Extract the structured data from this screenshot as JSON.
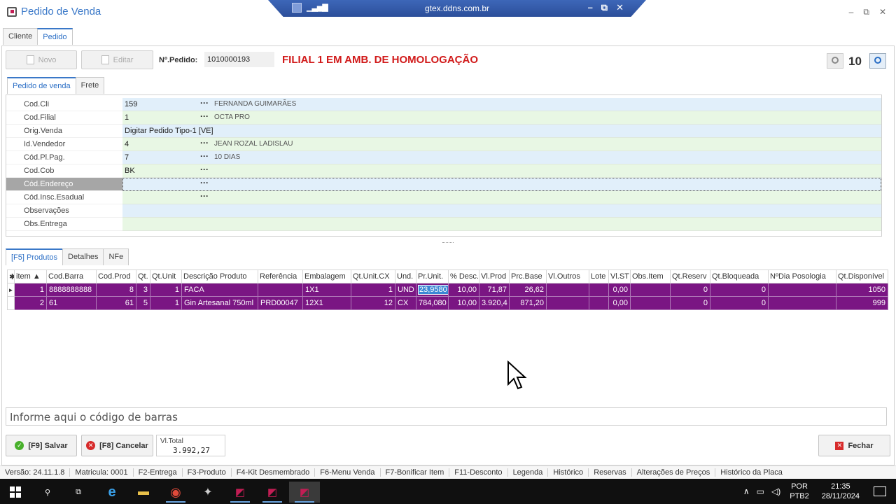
{
  "window": {
    "title": "Pedido de Venda",
    "rdp_host": "gtex.ddns.com.br"
  },
  "top_tabs": [
    "Cliente",
    "Pedido"
  ],
  "toolbar": {
    "new_label": "Novo",
    "edit_label": "Editar",
    "order_label": "Nº.Pedido:",
    "order_number": "1010000193",
    "banner": "FILIAL 1 EM AMB. DE HOMOLOGAÇÃO",
    "zoom": "10"
  },
  "form_tabs": [
    "Pedido de venda",
    "Frete"
  ],
  "form_rows": [
    {
      "label": "Cod.Cli",
      "code": "159",
      "dots": "···",
      "desc": "FERNANDA GUIMARÃES"
    },
    {
      "label": "Cod.Filial",
      "code": "1",
      "dots": "···",
      "desc": "OCTA PRO"
    },
    {
      "label": "Orig.Venda",
      "code": "Digitar Pedido Tipo-1 [VE]",
      "dots": "",
      "desc": ""
    },
    {
      "label": "Id.Vendedor",
      "code": "4",
      "dots": "···",
      "desc": "JEAN ROZAL LADISLAU"
    },
    {
      "label": "Cód.Pl.Pag.",
      "code": "7",
      "dots": "···",
      "desc": "10 DIAS"
    },
    {
      "label": "Cod.Cob",
      "code": "BK",
      "dots": "···",
      "desc": ""
    },
    {
      "label": "Cód.Endereço",
      "code": "",
      "dots": "···",
      "desc": ""
    },
    {
      "label": "Cód.Insc.Esadual",
      "code": "",
      "dots": "···",
      "desc": ""
    },
    {
      "label": "Observações",
      "code": "",
      "dots": "",
      "desc": ""
    },
    {
      "label": "Obs.Entrega",
      "code": "",
      "dots": "",
      "desc": ""
    }
  ],
  "product_tabs": [
    "[F5] Produtos",
    "Detalhes",
    "NFe"
  ],
  "products": {
    "columns": [
      "item",
      "Cod.Barra",
      "Cod.Prod",
      "Qt.",
      "Qt.Unit",
      "Descrição Produto",
      "Referência",
      "Embalagem",
      "Qt.Unit.CX",
      "Und.",
      "Pr.Unit.",
      "% Desc.",
      "Vl.Prod",
      "Prc.Base",
      "Vl.Outros",
      "Lote",
      "Vl.ST",
      "Obs.Item",
      "Qt.Reserv",
      "Qt.Bloqueada",
      "NºDia Posologia",
      "Qt.Disponível"
    ],
    "rows": [
      [
        "1",
        "8888888888",
        "8",
        "3",
        "1",
        "FACA",
        "",
        "1X1",
        "1",
        "UND",
        "23,9580",
        "10,00",
        "71,87",
        "26,62",
        "",
        "",
        "0,00",
        "",
        "0",
        "0",
        "",
        "1050"
      ],
      [
        "2",
        "61",
        "61",
        "5",
        "1",
        "Gin Artesanal 750ml",
        "PRD00047",
        "12X1",
        "12",
        "CX",
        "784,080",
        "10,00",
        "3.920,4",
        "871,20",
        "",
        "",
        "0,00",
        "",
        "0",
        "0",
        "",
        "999"
      ]
    ]
  },
  "barcode_placeholder": "Informe aqui o código de barras",
  "actions": {
    "save": "[F9] Salvar",
    "cancel": "[F8] Cancelar",
    "total_label": "Vl.Total",
    "total_value": "3.992,27",
    "close": "Fechar"
  },
  "status_bar": [
    "Versão: 24.11.1.8",
    "Matricula: 0001",
    "F2-Entrega",
    "F3-Produto",
    "F4-Kit Desmembrado",
    "F6-Menu Venda",
    "F7-Bonificar Item",
    "F11-Desconto",
    "Legenda",
    "Histórico",
    "Reservas",
    "Alterações de Preços",
    "Histórico da Placa"
  ],
  "taskbar": {
    "lang_top": "POR",
    "lang_bottom": "PTB2",
    "time": "21:35",
    "date": "28/11/2024"
  },
  "colors": {
    "accent": "#3a78c8",
    "banner_red": "#d11a1a",
    "row_selected": "#7a1683"
  }
}
